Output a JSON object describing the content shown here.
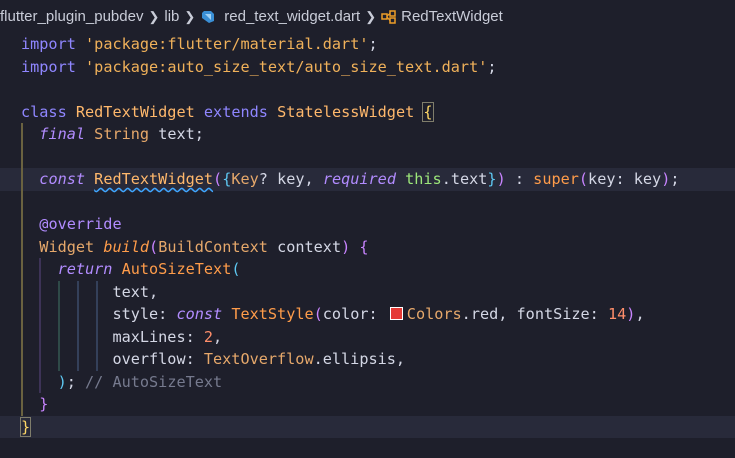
{
  "breadcrumb": {
    "project": "flutter_plugin_pubdev",
    "folder": "lib",
    "file": "red_text_widget.dart",
    "symbol": "RedTextWidget"
  },
  "colors": {
    "background": "#1e1f2b",
    "swatch_red": "#e53935"
  },
  "icons": {
    "separator": "chevron-right-icon",
    "file": "dart-file-icon",
    "symbol": "class-symbol-icon"
  },
  "code": {
    "l1": [
      "import",
      " ",
      "'package:flutter/material.dart'",
      ";"
    ],
    "l2": [
      "import",
      " ",
      "'package:auto_size_text/auto_size_text.dart'",
      ";"
    ],
    "l4": [
      "class",
      " ",
      "RedTextWidget",
      " ",
      "extends",
      " ",
      "StatelessWidget",
      " ",
      "{"
    ],
    "l5": [
      "final",
      " ",
      "String",
      " text;"
    ],
    "l7": [
      "const",
      " ",
      "RedTextWidget",
      "(",
      "{",
      "Key",
      "? key, ",
      "required",
      " ",
      "this",
      ".text",
      "}",
      ")",
      " : ",
      "super",
      "(",
      "key: key",
      ")",
      ";"
    ],
    "l9": [
      "@override"
    ],
    "l10": [
      "Widget",
      " ",
      "build",
      "(",
      "BuildContext",
      " context",
      ")",
      " {"
    ],
    "l11": [
      "return",
      " ",
      "AutoSizeText",
      "("
    ],
    "l12": [
      "text,"
    ],
    "l13": [
      "style: ",
      "const",
      " ",
      "TextStyle",
      "(",
      "color: ",
      "Colors",
      ".red, fontSize: ",
      "14",
      ")",
      ","
    ],
    "l14": [
      "maxLines: ",
      "2",
      ","
    ],
    "l15": [
      "overflow: ",
      "TextOverflow",
      ".ellipsis,"
    ],
    "l16": [
      ")",
      "; ",
      "// AutoSizeText"
    ],
    "l17": [
      "}"
    ],
    "l18": [
      "}"
    ]
  }
}
